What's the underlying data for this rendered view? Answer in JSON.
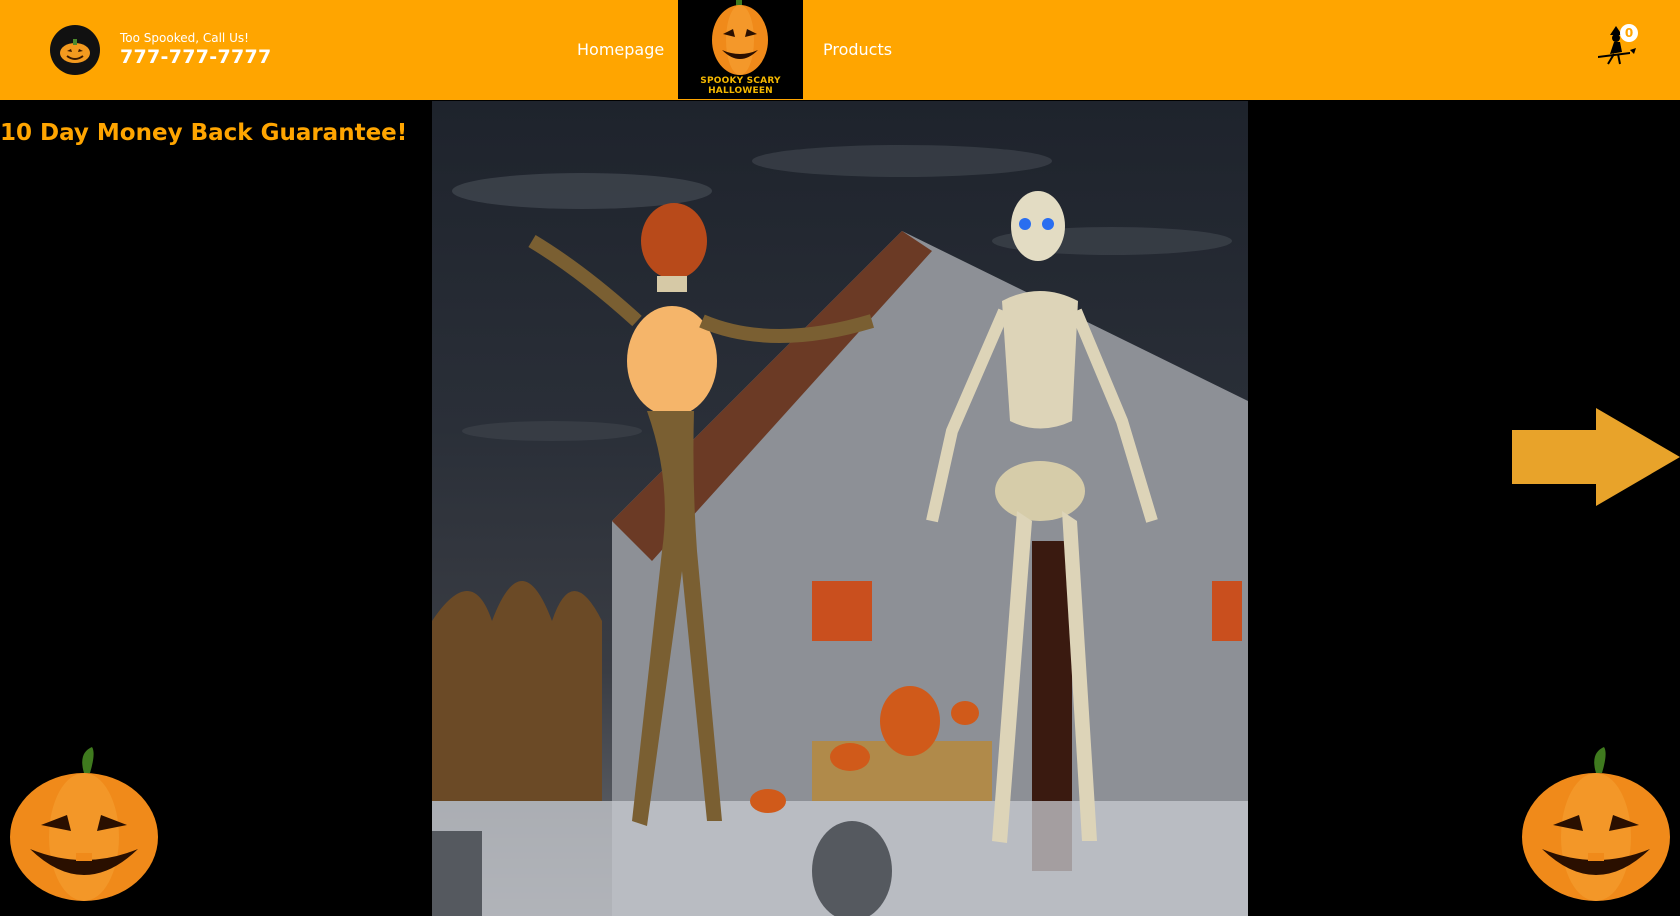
{
  "header": {
    "call_prompt": "Too Spooked, Call Us!",
    "phone": "777-777-7777",
    "nav": {
      "homepage": "Homepage",
      "products": "Products"
    },
    "logo_text": "SPOOKY SCARY HALLOWEEN",
    "cart_count": "0"
  },
  "main": {
    "guarantee": "10 Day Money Back Guarantee!"
  },
  "colors": {
    "brand": "#ffa500",
    "background": "#000000",
    "arrow": "#e8a32a"
  },
  "icons": [
    "pumpkin-icon",
    "witch-cart-icon",
    "next-arrow-icon"
  ]
}
